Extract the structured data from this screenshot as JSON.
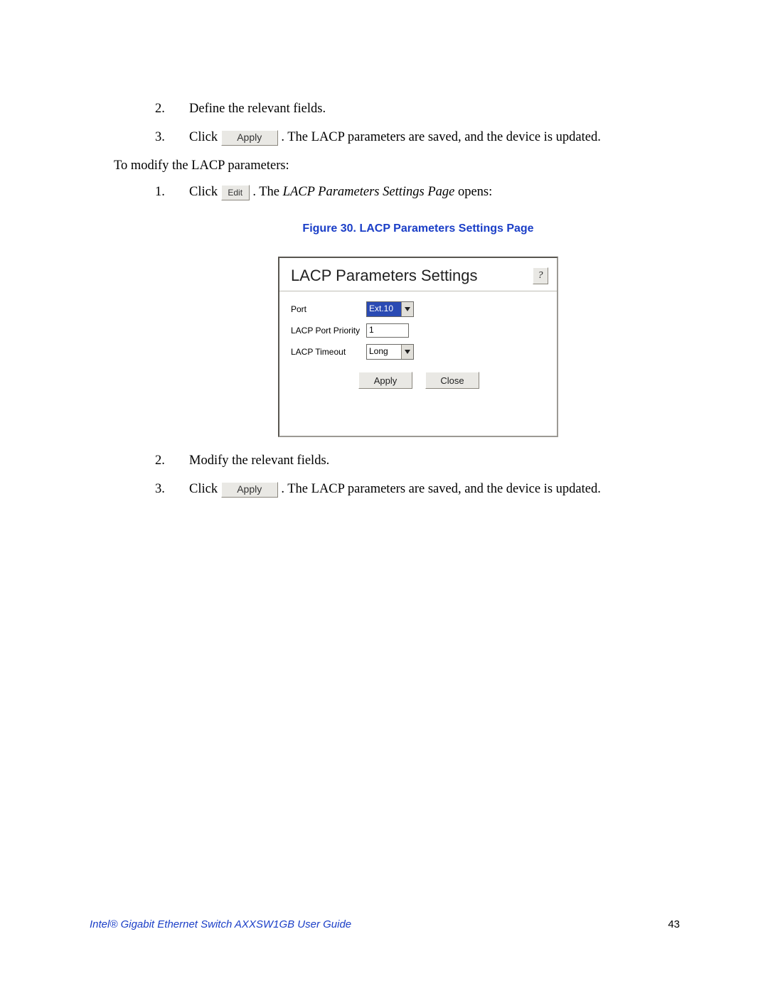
{
  "steps_top": {
    "s2_num": "2.",
    "s2_text": "Define the relevant fields.",
    "s3_num": "3.",
    "s3_pre": "Click ",
    "s3_btn": "Apply",
    "s3_post": ". The LACP parameters are saved, and the device is updated."
  },
  "intro_modify": "To modify the LACP parameters:",
  "steps_mid": {
    "s1_num": "1.",
    "s1_pre": "Click ",
    "s1_btn": "Edit",
    "s1_post_a": ". The ",
    "s1_post_italic": "LACP Parameters Settings Page",
    "s1_post_b": " opens:"
  },
  "figure_caption": "Figure 30. LACP Parameters Settings Page",
  "dialog": {
    "title": "LACP Parameters Settings",
    "help": "?",
    "fields": {
      "port_label": "Port",
      "port_value": "Ext.10",
      "priority_label": "LACP Port Priority",
      "priority_value": "1",
      "timeout_label": "LACP Timeout",
      "timeout_value": "Long"
    },
    "buttons": {
      "apply": "Apply",
      "close": "Close"
    }
  },
  "steps_bottom": {
    "s2_num": "2.",
    "s2_text": "Modify the relevant fields.",
    "s3_num": "3.",
    "s3_pre": "Click ",
    "s3_btn": "Apply",
    "s3_post": ". The LACP parameters are saved, and the device is updated."
  },
  "footer": {
    "title": "Intel® Gigabit Ethernet Switch AXXSW1GB User Guide",
    "page": "43"
  }
}
